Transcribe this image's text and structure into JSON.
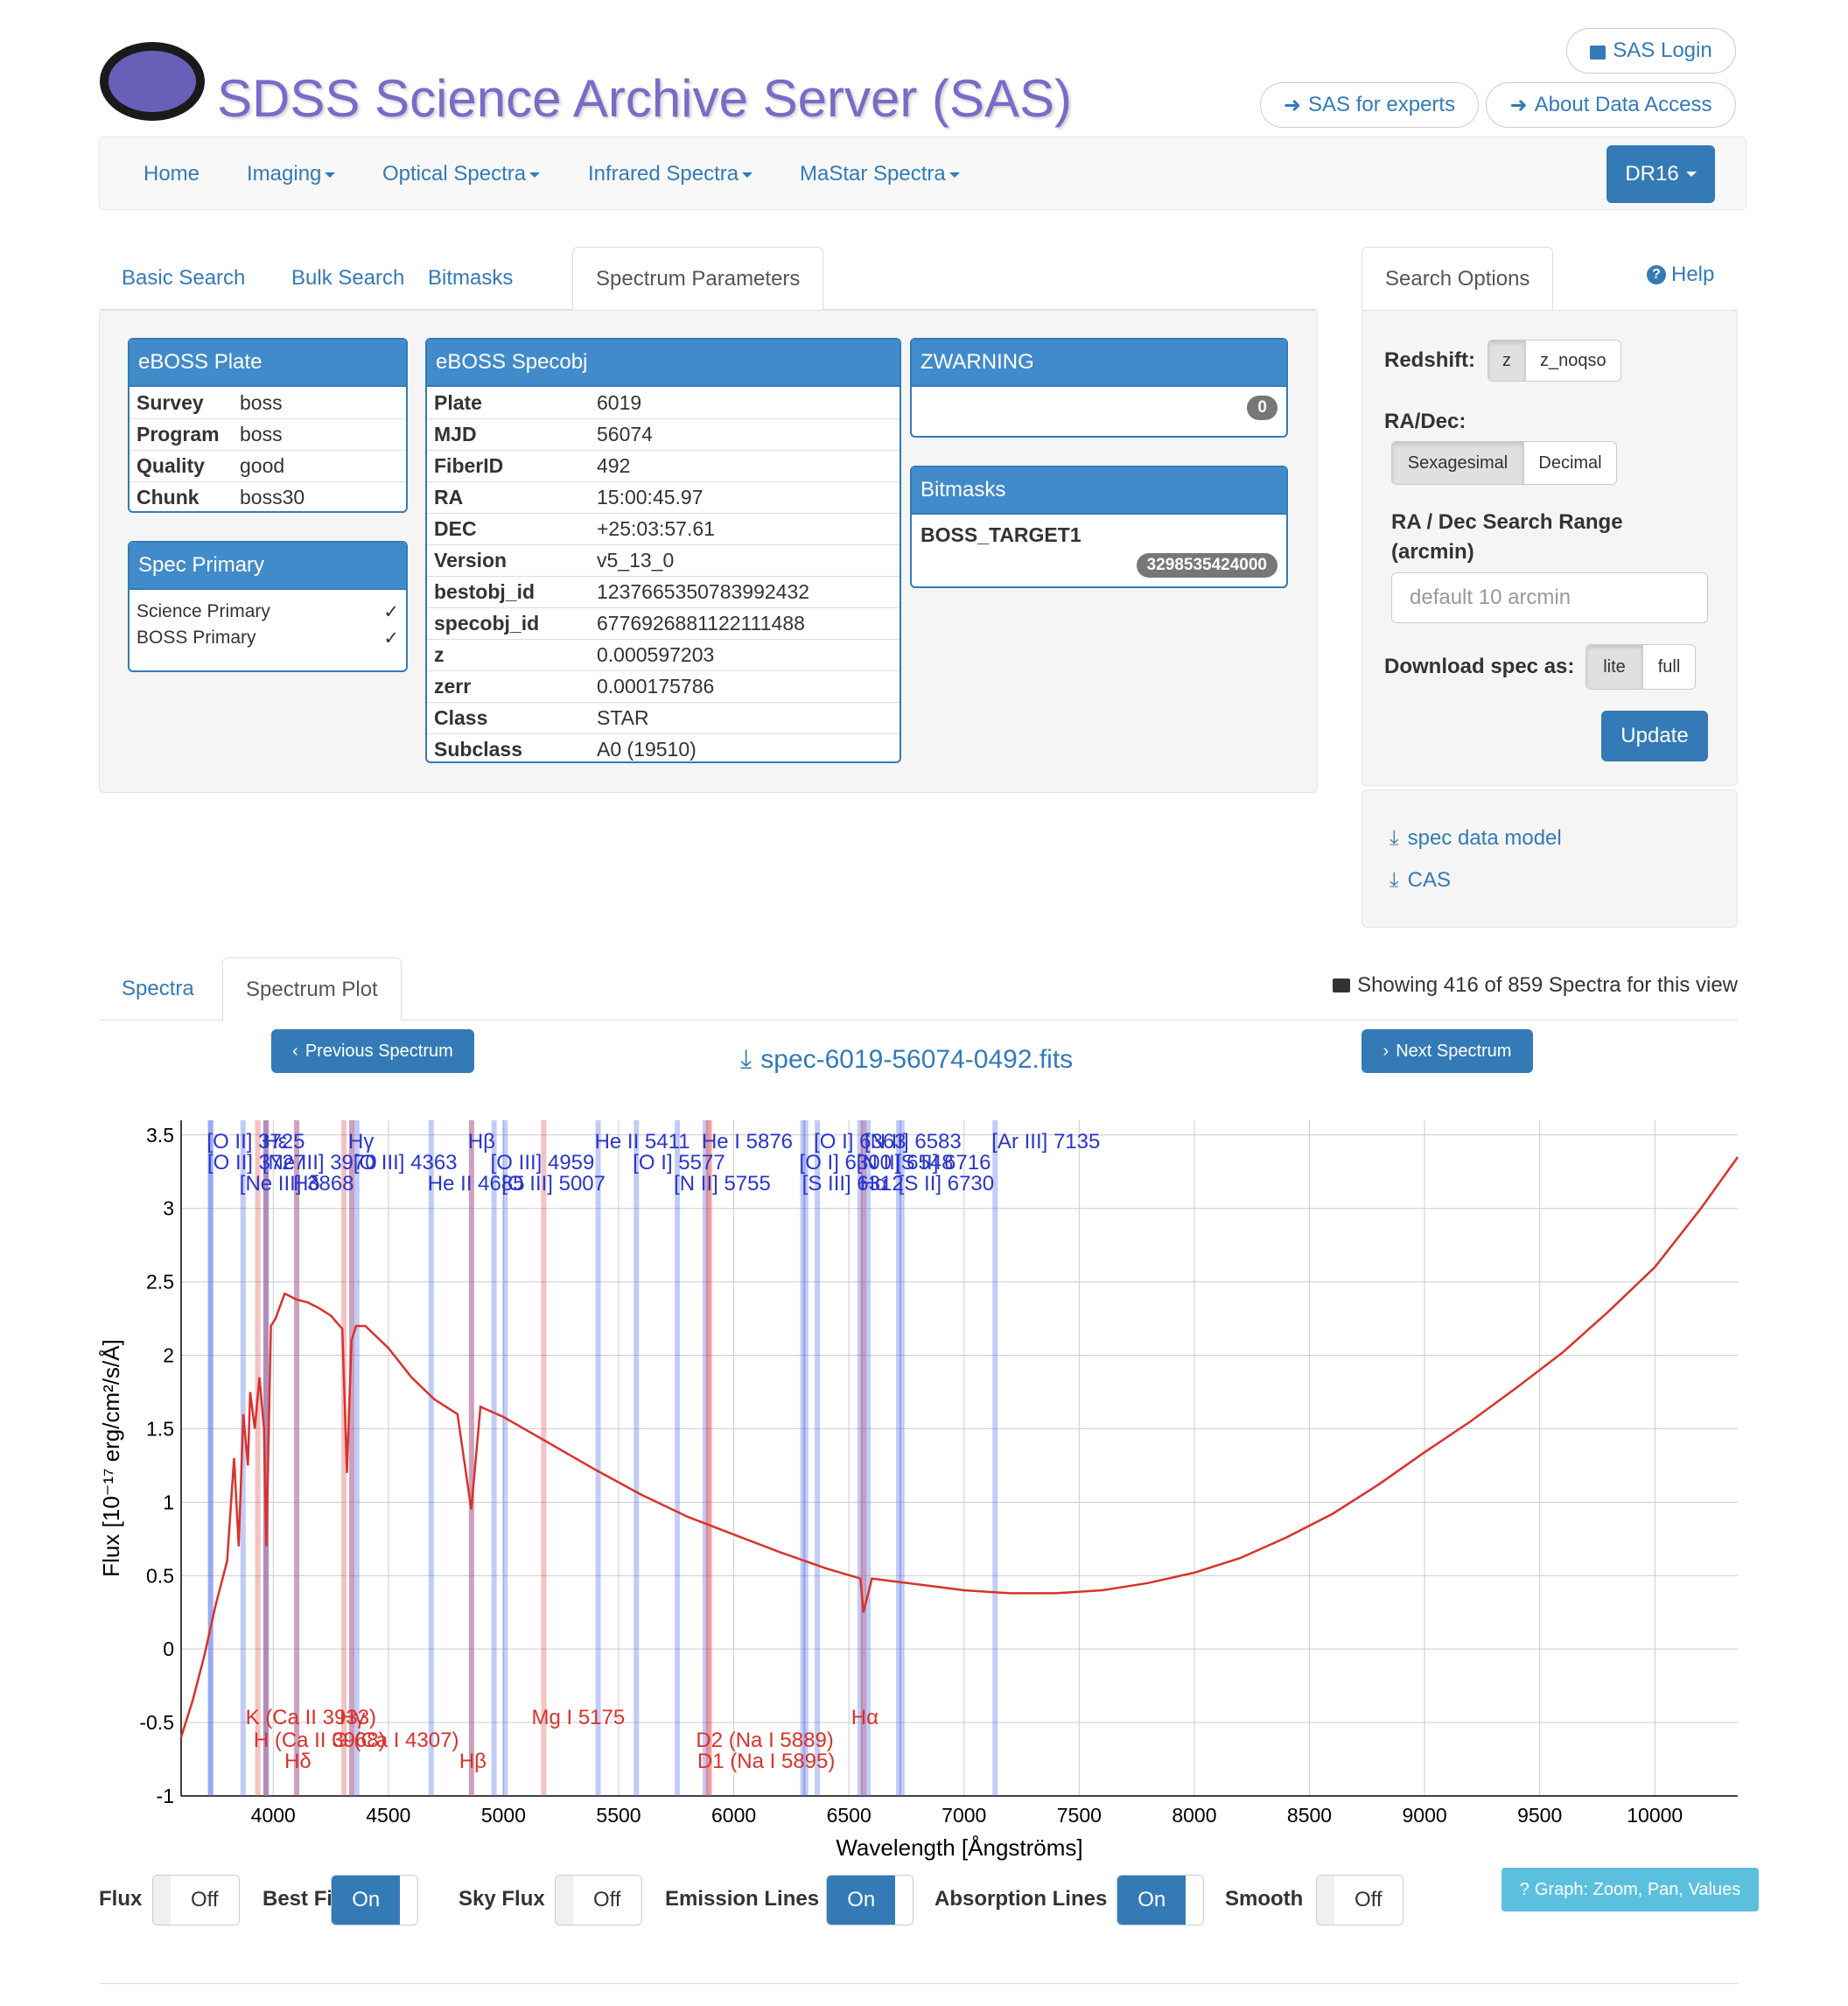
{
  "header": {
    "title": "SDSS Science Archive Server (SAS)",
    "login": "SAS Login",
    "experts": "SAS for experts",
    "about": "About Data Access"
  },
  "nav": {
    "items": [
      "Home",
      "Imaging",
      "Optical Spectra",
      "Infrared Spectra",
      "MaStar Spectra"
    ],
    "release": "DR16"
  },
  "search_tabs": [
    "Basic Search",
    "Bulk Search",
    "Bitmasks",
    "Spectrum Parameters"
  ],
  "plate": {
    "title": "eBOSS Plate",
    "rows": [
      [
        "Survey",
        "boss"
      ],
      [
        "Program",
        "boss"
      ],
      [
        "Quality",
        "good"
      ],
      [
        "Chunk",
        "boss30"
      ]
    ]
  },
  "spec_primary": {
    "title": "Spec Primary",
    "rows": [
      [
        "Science Primary",
        "✓"
      ],
      [
        "BOSS Primary",
        "✓"
      ]
    ]
  },
  "specobj": {
    "title": "eBOSS Specobj",
    "rows": [
      [
        "Plate",
        "6019"
      ],
      [
        "MJD",
        "56074"
      ],
      [
        "FiberID",
        "492"
      ],
      [
        "RA",
        "15:00:45.97"
      ],
      [
        "DEC",
        "+25:03:57.61"
      ],
      [
        "Version",
        "v5_13_0"
      ],
      [
        "bestobj_id",
        "1237665350783992432"
      ],
      [
        "specobj_id",
        "6776926881122111488"
      ],
      [
        "z",
        "0.000597203"
      ],
      [
        "zerr",
        "0.000175786"
      ],
      [
        "Class",
        "STAR"
      ],
      [
        "Subclass",
        "A0 (19510)"
      ]
    ]
  },
  "zwarning": {
    "title": "ZWARNING",
    "value": "0"
  },
  "bitmasks": {
    "title": "Bitmasks",
    "name": "BOSS_TARGET1",
    "value": "3298535424000"
  },
  "options": {
    "tab": "Search Options",
    "help": "Help",
    "redshift_label": "Redshift:",
    "redshift_opts": [
      "z",
      "z_noqso"
    ],
    "radec_label": "RA/Dec:",
    "radec_opts": [
      "Sexagesimal",
      "Decimal"
    ],
    "range_label": "RA / Dec Search Range (arcmin)",
    "range_placeholder": "default 10 arcmin",
    "download_label": "Download spec as:",
    "download_opts": [
      "lite",
      "full"
    ],
    "update": "Update",
    "links": [
      "spec data model",
      "CAS"
    ]
  },
  "lower_tabs": [
    "Spectra",
    "Spectrum Plot"
  ],
  "showing": "Showing 416 of 859 Spectra for this view",
  "prev": "Previous Spectrum",
  "next": "Next Spectrum",
  "filename": "spec-6019-56074-0492.fits",
  "toggles": [
    {
      "label": "Flux",
      "state": "Off"
    },
    {
      "label": "Best Fit",
      "state": "On"
    },
    {
      "label": "Sky Flux",
      "state": "Off"
    },
    {
      "label": "Emission Lines",
      "state": "On"
    },
    {
      "label": "Absorption Lines",
      "state": "On"
    },
    {
      "label": "Smooth",
      "state": "Off"
    }
  ],
  "graph_button": "Graph: Zoom, Pan, Values",
  "chart_data": {
    "type": "line",
    "xlabel": "Wavelength [Ångströms]",
    "ylabel": "Flux [10⁻¹⁷ erg/cm²/s/Å]",
    "xlim": [
      3600,
      10360
    ],
    "ylim": [
      -1,
      3.6
    ],
    "x_ticks": [
      "4000",
      "4500",
      "5000",
      "5500",
      "6000",
      "6500",
      "7000",
      "7500",
      "8000",
      "8500",
      "9000",
      "9500",
      "10000"
    ],
    "y_ticks": [
      "3.5",
      "3",
      "2.5",
      "2",
      "1.5",
      "1",
      "0.5",
      "0",
      "-0.5",
      "-1"
    ],
    "series": [
      {
        "color": "#d9322b",
        "x": [
          3600,
          3650,
          3700,
          3750,
          3800,
          3830,
          3850,
          3870,
          3890,
          3900,
          3920,
          3940,
          3960,
          3970,
          3990,
          4010,
          4050,
          4100,
          4150,
          4200,
          4250,
          4300,
          4320,
          4340,
          4360,
          4400,
          4500,
          4600,
          4700,
          4800,
          4860,
          4900,
          5000,
          5200,
          5400,
          5600,
          5800,
          6000,
          6200,
          6400,
          6550,
          6563,
          6600,
          6800,
          7000,
          7200,
          7400,
          7600,
          7800,
          8000,
          8200,
          8400,
          8600,
          8800,
          9000,
          9200,
          9400,
          9600,
          9800,
          10000,
          10100,
          10200,
          10360
        ],
        "y": [
          -0.6,
          -0.35,
          -0.05,
          0.3,
          0.6,
          1.3,
          0.7,
          1.6,
          1.25,
          1.75,
          1.5,
          1.85,
          1.5,
          0.7,
          2.2,
          2.25,
          2.42,
          2.38,
          2.36,
          2.32,
          2.27,
          2.18,
          1.2,
          2.1,
          2.2,
          2.2,
          2.05,
          1.85,
          1.7,
          1.6,
          0.95,
          1.65,
          1.58,
          1.4,
          1.22,
          1.05,
          0.9,
          0.78,
          0.66,
          0.55,
          0.48,
          0.25,
          0.48,
          0.44,
          0.4,
          0.38,
          0.38,
          0.4,
          0.45,
          0.52,
          0.62,
          0.76,
          0.92,
          1.12,
          1.34,
          1.55,
          1.78,
          2.02,
          2.3,
          2.6,
          2.8,
          3.0,
          3.35
        ]
      }
    ],
    "emission_lines": [
      {
        "name": "[O II] 3725",
        "x": 3727
      },
      {
        "name": "[O II] 3727",
        "x": 3729
      },
      {
        "name": "[Ne III] 3868",
        "x": 3869
      },
      {
        "name": "Hε",
        "x": 3970
      },
      {
        "name": "[Ne III] 3970",
        "x": 3968
      },
      {
        "name": "Hδ",
        "x": 4102
      },
      {
        "name": "Hγ",
        "x": 4341
      },
      {
        "name": "[O III] 4363",
        "x": 4363
      },
      {
        "name": "He II 4685",
        "x": 4686
      },
      {
        "name": "Hβ",
        "x": 4861
      },
      {
        "name": "[O III] 4959",
        "x": 4959
      },
      {
        "name": "[O III] 5007",
        "x": 5007
      },
      {
        "name": "He II 5411",
        "x": 5411
      },
      {
        "name": "[O I] 5577",
        "x": 5577
      },
      {
        "name": "[N II] 5755",
        "x": 5755
      },
      {
        "name": "He I 5876",
        "x": 5876
      },
      {
        "name": "[O I] 6300",
        "x": 6300
      },
      {
        "name": "[S III] 6312",
        "x": 6312
      },
      {
        "name": "[O I] 6363",
        "x": 6363
      },
      {
        "name": "[N II] 6548",
        "x": 6548
      },
      {
        "name": "Hα",
        "x": 6563
      },
      {
        "name": "[N II] 6583",
        "x": 6583
      },
      {
        "name": "[S II] 6716",
        "x": 6716
      },
      {
        "name": "[S II] 6730",
        "x": 6730
      },
      {
        "name": "[Ar III] 7135",
        "x": 7135
      }
    ],
    "absorption_lines": [
      {
        "name": "K (Ca II 3933)",
        "x": 3933
      },
      {
        "name": "H (Ca II 3968)",
        "x": 3968
      },
      {
        "name": "Hδ",
        "x": 4102
      },
      {
        "name": "Hγ",
        "x": 4341
      },
      {
        "name": "G (Ca I 4307)",
        "x": 4307
      },
      {
        "name": "Hβ",
        "x": 4861
      },
      {
        "name": "Mg I 5175",
        "x": 5175
      },
      {
        "name": "D2 (Na I 5889)",
        "x": 5889
      },
      {
        "name": "D1 (Na I 5895)",
        "x": 5895
      },
      {
        "name": "Hα",
        "x": 6563
      }
    ]
  }
}
